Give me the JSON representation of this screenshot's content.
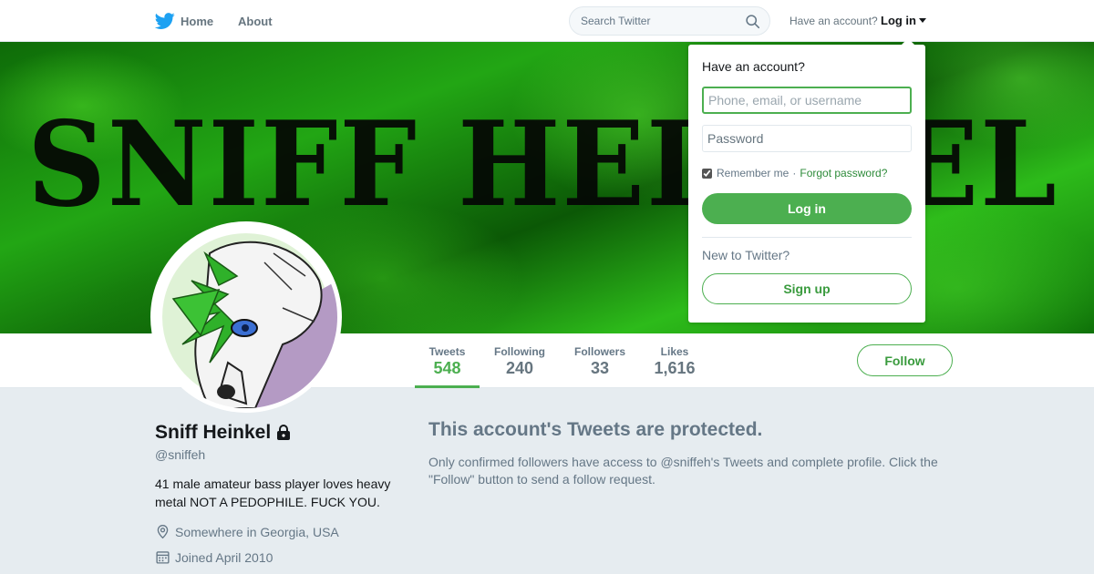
{
  "nav": {
    "home_label": "Home",
    "about_label": "About",
    "bird_icon": "twitter-bird-icon",
    "search_placeholder": "Search Twitter",
    "search_icon": "search-icon",
    "account_hint": "Have an account?",
    "login_label": "Log in"
  },
  "banner": {
    "text": "SNIFF HEINKEL"
  },
  "profile": {
    "name": "Sniff Heinkel",
    "handle": "@sniffeh",
    "bio": "41 male amateur bass player loves heavy metal NOT A PEDOPHILE. FUCK YOU.",
    "location": "Somewhere in Georgia, USA",
    "joined": "Joined April 2010",
    "lock_icon": "lock-icon",
    "location_icon": "map-pin-icon",
    "calendar_icon": "calendar-icon"
  },
  "stats": {
    "tweets_label": "Tweets",
    "tweets_value": "548",
    "following_label": "Following",
    "following_value": "240",
    "followers_label": "Followers",
    "followers_value": "33",
    "likes_label": "Likes",
    "likes_value": "1,616",
    "active_tab": "Tweets"
  },
  "follow_label": "Follow",
  "protected": {
    "title": "This account's Tweets are protected.",
    "text": "Only confirmed followers have access to @sniffeh's Tweets and complete profile. Click the \"Follow\" button to send a follow request."
  },
  "login_dropdown": {
    "heading": "Have an account?",
    "username_placeholder": "Phone, email, or username",
    "password_placeholder": "Password",
    "remember_label": "Remember me",
    "separator": "·",
    "forgot_label": "Forgot password?",
    "remember_checked": true,
    "login_button": "Log in",
    "new_prompt": "New to Twitter?",
    "signup_button": "Sign up"
  },
  "colors": {
    "accent": "#4caf50",
    "nav_blue": "#1da1f2",
    "text_secondary": "#657786",
    "page_bg": "#e6ecf0"
  }
}
